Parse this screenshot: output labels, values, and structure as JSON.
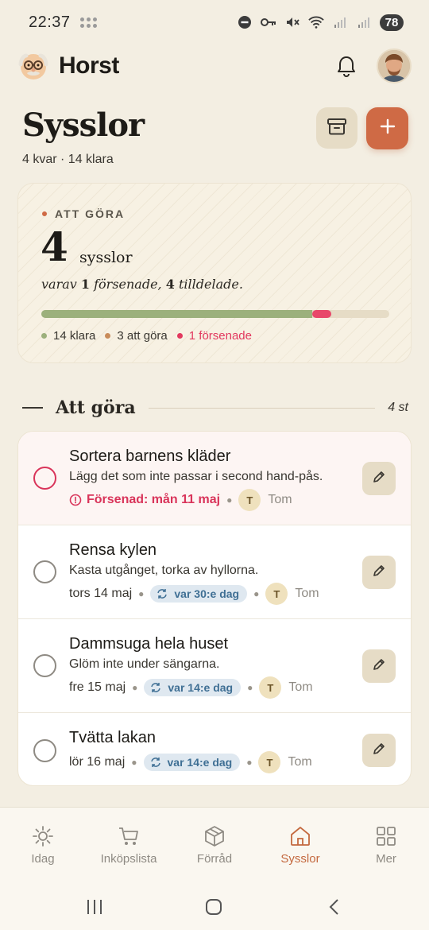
{
  "status_bar": {
    "time": "22:37",
    "battery": "78"
  },
  "header": {
    "app_name": "Horst",
    "logo_icon": "grandpa-face-icon",
    "notification_icon": "bell-icon"
  },
  "page": {
    "title": "Sysslor",
    "subtitle": "4 kvar · 14 klara",
    "archive_icon": "archive-box-icon",
    "add_icon": "plus-icon"
  },
  "summary": {
    "label": "ATT GÖRA",
    "count": "4",
    "unit": "sysslor",
    "detail_prefix": "varav ",
    "overdue_count": "1",
    "overdue_text": " försenade, ",
    "assigned_count": "4",
    "assigned_text": " tilldelade.",
    "progress": {
      "done": 14,
      "todo": 3,
      "overdue": 1
    },
    "legend": [
      {
        "label": "14 klara",
        "color": "#9cb07c"
      },
      {
        "label": "3 att göra",
        "color": "#c98c5a"
      },
      {
        "label": "1 försenade",
        "color": "#e2395f"
      }
    ],
    "colors": {
      "done": "#9cb07c",
      "overdue": "#e8476a",
      "track": "#e6dcc6"
    }
  },
  "section": {
    "title": "Att göra",
    "count": "4 st"
  },
  "tasks": [
    {
      "title": "Sortera barnens kläder",
      "description": "Lägg det som inte passar i second hand-pås.",
      "due": "Försenad: mån 11 maj",
      "overdue": true,
      "repeat": "",
      "assignee_initial": "T",
      "assignee_name": "Tom"
    },
    {
      "title": "Rensa kylen",
      "description": "Kasta utgånget, torka av hyllorna.",
      "due": "tors 14 maj",
      "overdue": false,
      "repeat": "var 30:e dag",
      "assignee_initial": "T",
      "assignee_name": "Tom"
    },
    {
      "title": "Dammsuga hela huset",
      "description": "Glöm inte under sängarna.",
      "due": "fre 15 maj",
      "overdue": false,
      "repeat": "var 14:e dag",
      "assignee_initial": "T",
      "assignee_name": "Tom"
    },
    {
      "title": "Tvätta lakan",
      "description": "",
      "due": "lör 16 maj",
      "overdue": false,
      "repeat": "var 14:e dag",
      "assignee_initial": "T",
      "assignee_name": "Tom"
    }
  ],
  "bottom_nav": [
    {
      "label": "Idag",
      "icon": "sun-icon",
      "active": false
    },
    {
      "label": "Inköpslista",
      "icon": "cart-icon",
      "active": false
    },
    {
      "label": "Förråd",
      "icon": "box-icon",
      "active": false
    },
    {
      "label": "Sysslor",
      "icon": "house-icon",
      "active": true
    },
    {
      "label": "Mer",
      "icon": "grid-icon",
      "active": false
    }
  ],
  "colors": {
    "accent": "#cf6a45",
    "background": "#f3eee2",
    "overdue": "#d9345a",
    "repeat_pill": "#dfe8f0"
  }
}
